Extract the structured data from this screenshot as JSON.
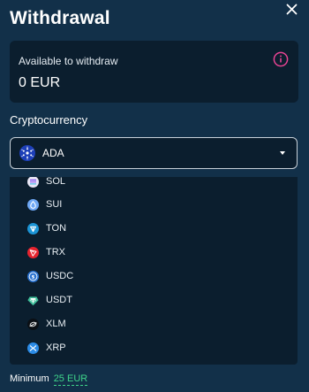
{
  "dialog": {
    "title": "Withdrawal"
  },
  "balance": {
    "label": "Available to withdraw",
    "value": "0 EUR"
  },
  "crypto": {
    "label": "Cryptocurrency",
    "selected": "ADA",
    "options": [
      {
        "label": "SOL",
        "icon": "sol-icon"
      },
      {
        "label": "SUI",
        "icon": "sui-icon"
      },
      {
        "label": "TON",
        "icon": "ton-icon"
      },
      {
        "label": "TRX",
        "icon": "trx-icon"
      },
      {
        "label": "USDC",
        "icon": "usdc-icon"
      },
      {
        "label": "USDT",
        "icon": "usdt-icon"
      },
      {
        "label": "XLM",
        "icon": "xlm-icon"
      },
      {
        "label": "XRP",
        "icon": "xrp-icon"
      }
    ]
  },
  "minimum": {
    "label": "Minimum",
    "amount": "25 EUR"
  },
  "colors": {
    "background": "#123049",
    "panel": "#0b1e2e",
    "accent_info": "#e84393",
    "accent_min": "#3fd48a"
  }
}
